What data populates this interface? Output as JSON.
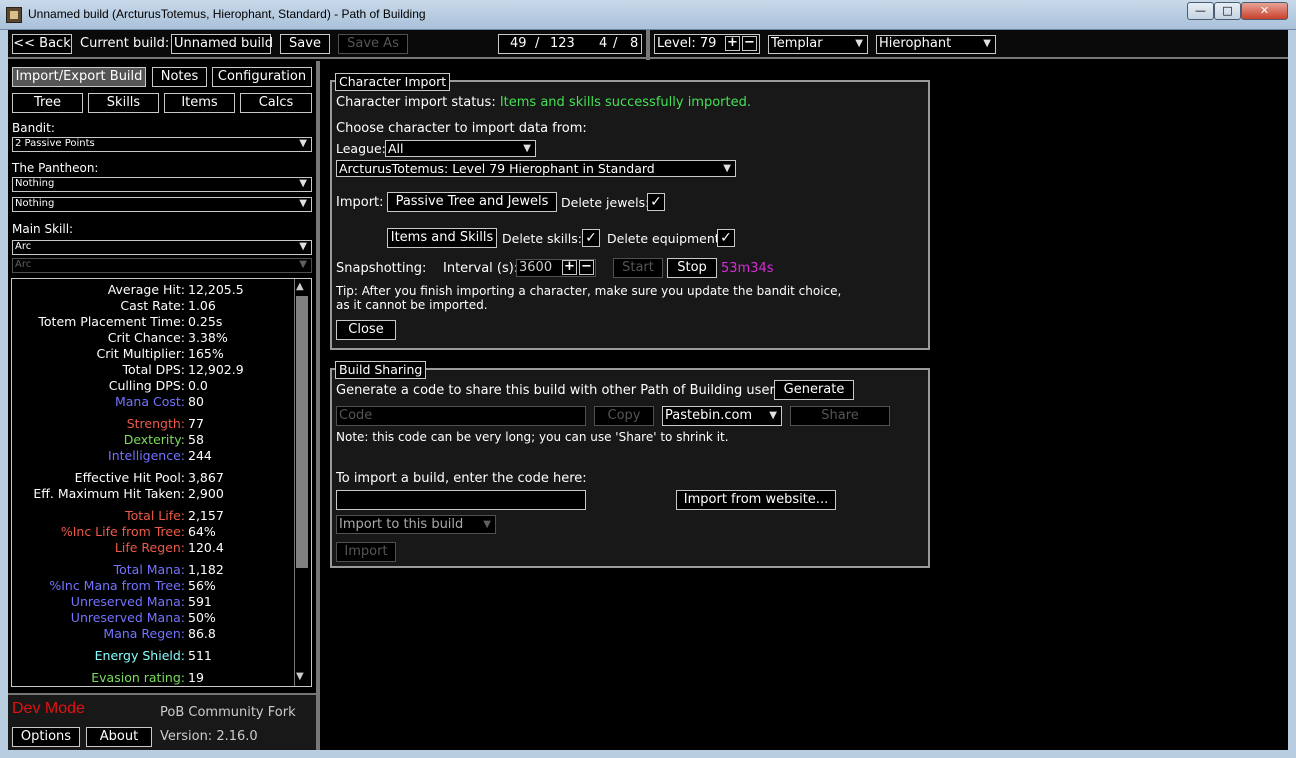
{
  "window": {
    "title": "Unnamed build (ArcturusTotemus, Hierophant, Standard) - Path of Building",
    "minimize_glyph": "—",
    "maximize_glyph": "□",
    "close_glyph": "✕"
  },
  "topbar": {
    "back_label": "<< Back",
    "current_build_label": "Current build:",
    "build_name": "Unnamed build",
    "save_label": "Save",
    "save_as_label": "Save As",
    "points_used": "49",
    "points_sep": "/",
    "points_total": "123",
    "ascend_used": "4",
    "ascend_sep": "/",
    "ascend_total": "8",
    "level_label": "Level:",
    "level_value": "79",
    "class": "Templar",
    "ascendancy": "Hierophant"
  },
  "left": {
    "tabs_row1": [
      "Import/Export Build",
      "Notes",
      "Configuration"
    ],
    "tabs_row2": [
      "Tree",
      "Skills",
      "Items",
      "Calcs"
    ],
    "bandit_label": "Bandit:",
    "bandit_value": "2 Passive Points",
    "pantheon_label": "The Pantheon:",
    "pantheon_major": "Nothing",
    "pantheon_minor": "Nothing",
    "main_skill_label": "Main Skill:",
    "main_skill": "Arc",
    "main_skill_part": "Arc",
    "stats": [
      {
        "label": "Average Hit:",
        "value": "12,205.5",
        "color": "white"
      },
      {
        "label": "Cast Rate:",
        "value": "1.06",
        "color": "white"
      },
      {
        "label": "Totem Placement Time:",
        "value": "0.25s",
        "color": "white"
      },
      {
        "label": "Crit Chance:",
        "value": "3.38%",
        "color": "white"
      },
      {
        "label": "Crit Multiplier:",
        "value": "165%",
        "color": "white"
      },
      {
        "label": "Total DPS:",
        "value": "12,902.9",
        "color": "white"
      },
      {
        "label": "Culling DPS:",
        "value": "0.0",
        "color": "white"
      },
      {
        "label": "Mana Cost:",
        "value": "80",
        "color": "mana"
      },
      {
        "label": "Strength:",
        "value": "77",
        "color": "str"
      },
      {
        "label": "Dexterity:",
        "value": "58",
        "color": "dex"
      },
      {
        "label": "Intelligence:",
        "value": "244",
        "color": "int"
      },
      {
        "label": "Effective Hit Pool:",
        "value": "3,867",
        "color": "white"
      },
      {
        "label": "Eff. Maximum Hit Taken:",
        "value": "2,900",
        "color": "white"
      },
      {
        "label": "Total Life:",
        "value": "2,157",
        "color": "life"
      },
      {
        "label": "%Inc Life from Tree:",
        "value": "64%",
        "color": "life"
      },
      {
        "label": "Life Regen:",
        "value": "120.4",
        "color": "life"
      },
      {
        "label": "Total Mana:",
        "value": "1,182",
        "color": "mana"
      },
      {
        "label": "%Inc Mana from Tree:",
        "value": "56%",
        "color": "mana"
      },
      {
        "label": "Unreserved Mana:",
        "value": "591",
        "color": "mana"
      },
      {
        "label": "Unreserved Mana:",
        "value": "50%",
        "color": "mana"
      },
      {
        "label": "Mana Regen:",
        "value": "86.8",
        "color": "mana"
      },
      {
        "label": "Energy Shield:",
        "value": "511",
        "color": "es"
      },
      {
        "label": "Evasion rating:",
        "value": "19",
        "color": "eva"
      }
    ],
    "dev_mode": "Dev Mode",
    "fork_name": "PoB Community Fork",
    "options_label": "Options",
    "about_label": "About",
    "version": "Version: 2.16.0"
  },
  "char_import": {
    "title": "Character Import",
    "status_label": "Character import status:",
    "status_value": "Items and skills successfully imported.",
    "choose_label": "Choose character to import data from:",
    "league_label": "League:",
    "league_value": "All",
    "character": "ArcturusTotemus: Level 79 Hierophant in Standard",
    "import_label": "Import:",
    "passive_btn": "Passive Tree and Jewels",
    "delete_jewels": "Delete jewels:",
    "items_btn": "Items and Skills",
    "delete_skills": "Delete skills:",
    "delete_equipment": "Delete equipment:",
    "snapshot_label": "Snapshotting:",
    "interval_label": "Interval (s):",
    "interval_value": "3600",
    "start_label": "Start",
    "stop_label": "Stop",
    "elapsed": "53m34s",
    "tip_line1": "Tip: After you finish importing a character, make sure you update the bandit choice,",
    "tip_line2": "as it cannot be imported.",
    "close_label": "Close",
    "check_glyph": "✓"
  },
  "build_sharing": {
    "title": "Build Sharing",
    "generate_text": "Generate a code to share this build with other Path of Building users:",
    "generate_btn": "Generate",
    "code_placeholder": "Code",
    "copy_btn": "Copy",
    "site": "Pastebin.com",
    "share_btn": "Share",
    "note": "Note: this code can be very long; you can use 'Share' to shrink it.",
    "import_text": "To import a build, enter the code here:",
    "import_website_btn": "Import from website...",
    "import_target": "Import to this build",
    "import_btn": "Import"
  },
  "colors": {
    "white": "#ffffff",
    "mana": "#7373ff",
    "str": "#ee5a4a",
    "dex": "#7bdc5a",
    "int": "#7373ff",
    "life": "#ee5a4a",
    "es": "#88ffff",
    "eva": "#7bdc5a",
    "success": "#44e055",
    "elapsed": "#d42fd4",
    "dev_mode": "#e21212"
  }
}
